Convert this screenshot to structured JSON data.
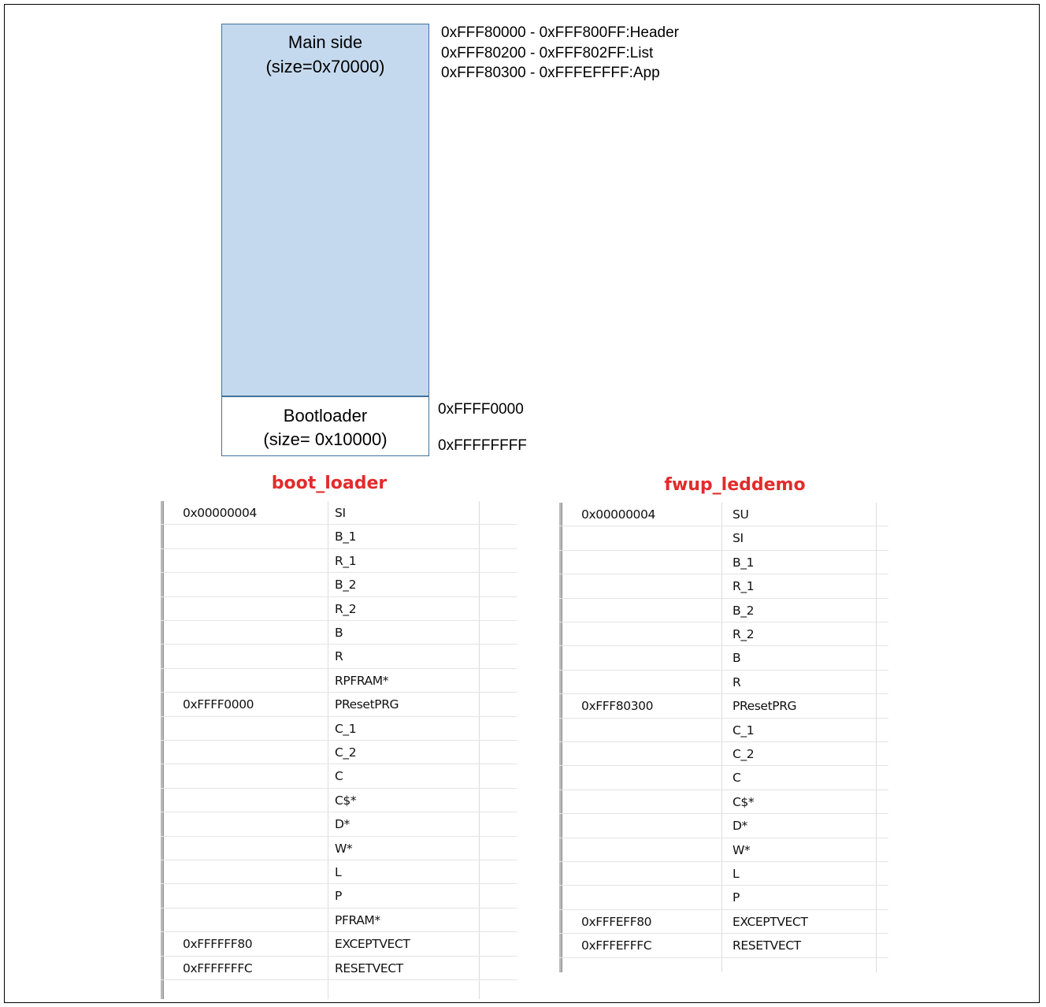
{
  "memory_map": {
    "main_side": {
      "label_1": "Main side",
      "label_2": "(size=0x70000)"
    },
    "bootloader": {
      "label_1": "Bootloader",
      "label_2": "(size= 0x10000)"
    },
    "main_addresses": [
      "0xFFF80000 - 0xFFF800FF:Header",
      "0xFFF80200 - 0xFFF802FF:List",
      "0xFFF80300 - 0xFFFEFFFF:App"
    ],
    "boot_start": "0xFFFF0000",
    "boot_end": "0xFFFFFFFF"
  },
  "boot_loader": {
    "title": "boot_loader",
    "rows": [
      {
        "addr": "0x00000004",
        "section": "SI"
      },
      {
        "addr": "",
        "section": "B_1"
      },
      {
        "addr": "",
        "section": "R_1"
      },
      {
        "addr": "",
        "section": "B_2"
      },
      {
        "addr": "",
        "section": "R_2"
      },
      {
        "addr": "",
        "section": "B"
      },
      {
        "addr": "",
        "section": "R"
      },
      {
        "addr": "",
        "section": "RPFRAM*"
      },
      {
        "addr": "0xFFFF0000",
        "section": "PResetPRG"
      },
      {
        "addr": "",
        "section": "C_1"
      },
      {
        "addr": "",
        "section": "C_2"
      },
      {
        "addr": "",
        "section": "C"
      },
      {
        "addr": "",
        "section": "C$*"
      },
      {
        "addr": "",
        "section": "D*"
      },
      {
        "addr": "",
        "section": "W*"
      },
      {
        "addr": "",
        "section": "L"
      },
      {
        "addr": "",
        "section": "P"
      },
      {
        "addr": "",
        "section": "PFRAM*"
      },
      {
        "addr": "0xFFFFFF80",
        "section": "EXCEPTVECT"
      },
      {
        "addr": "0xFFFFFFFC",
        "section": "RESETVECT"
      }
    ]
  },
  "fwup_leddemo": {
    "title": "fwup_leddemo",
    "rows": [
      {
        "addr": "0x00000004",
        "section": "SU"
      },
      {
        "addr": "",
        "section": "SI"
      },
      {
        "addr": "",
        "section": "B_1"
      },
      {
        "addr": "",
        "section": "R_1"
      },
      {
        "addr": "",
        "section": "B_2"
      },
      {
        "addr": "",
        "section": "R_2"
      },
      {
        "addr": "",
        "section": "B"
      },
      {
        "addr": "",
        "section": "R"
      },
      {
        "addr": "0xFFF80300",
        "section": "PResetPRG"
      },
      {
        "addr": "",
        "section": "C_1"
      },
      {
        "addr": "",
        "section": "C_2"
      },
      {
        "addr": "",
        "section": "C"
      },
      {
        "addr": "",
        "section": "C$*"
      },
      {
        "addr": "",
        "section": "D*"
      },
      {
        "addr": "",
        "section": "W*"
      },
      {
        "addr": "",
        "section": "L"
      },
      {
        "addr": "",
        "section": "P"
      },
      {
        "addr": "0xFFFEFF80",
        "section": "EXCEPTVECT"
      },
      {
        "addr": "0xFFFEFFFC",
        "section": "RESETVECT"
      }
    ]
  }
}
